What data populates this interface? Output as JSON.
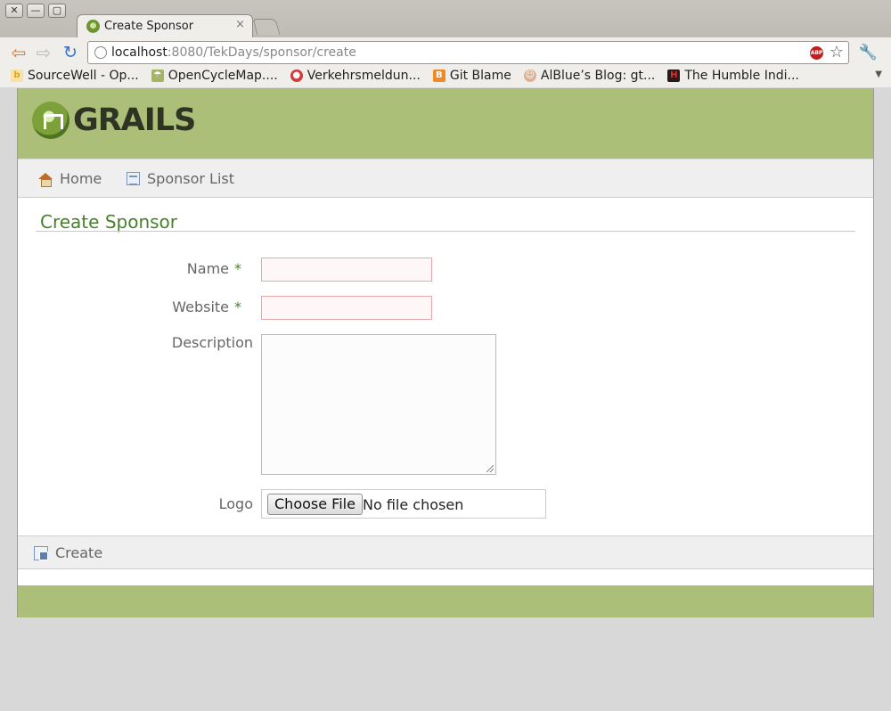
{
  "browser": {
    "window_controls": {
      "close": "✕",
      "minimize": "—",
      "maximize": "▢"
    },
    "tab": {
      "title": "Create Sponsor",
      "close": "×"
    },
    "url": {
      "host": "localhost",
      "path": ":8080/TekDays/sponsor/create"
    },
    "abp_label": "ABP",
    "bookmarks": [
      {
        "label": "SourceWell - Op...",
        "icon": "b",
        "color": "#e3a51a"
      },
      {
        "label": "OpenCycleMap....",
        "icon": "☂",
        "color": "#7a8b3a"
      },
      {
        "label": "Verkehrsmeldun...",
        "icon": "●",
        "color": "#d23b3b"
      },
      {
        "label": "Git Blame",
        "icon": "B",
        "color": "#f08a24"
      },
      {
        "label": "AlBlue’s Blog: gt...",
        "icon": "☺",
        "color": "#c89a7a"
      },
      {
        "label": "The Humble Indi...",
        "icon": "H",
        "color": "#b52020"
      }
    ]
  },
  "site": {
    "logo": "GRAILS",
    "nav": {
      "home": "Home",
      "list": "Sponsor List"
    },
    "title": "Create Sponsor"
  },
  "form": {
    "name_label": "Name",
    "website_label": "Website",
    "description_label": "Description",
    "logo_label": "Logo",
    "required_mark": "*",
    "name_value": "",
    "website_value": "",
    "description_value": "",
    "file_button": "Choose File",
    "file_status": "No file chosen",
    "create_label": "Create"
  },
  "colors": {
    "accent_green": "#abbf78",
    "title_green": "#48802c",
    "required_border": "#e8a9a9"
  }
}
